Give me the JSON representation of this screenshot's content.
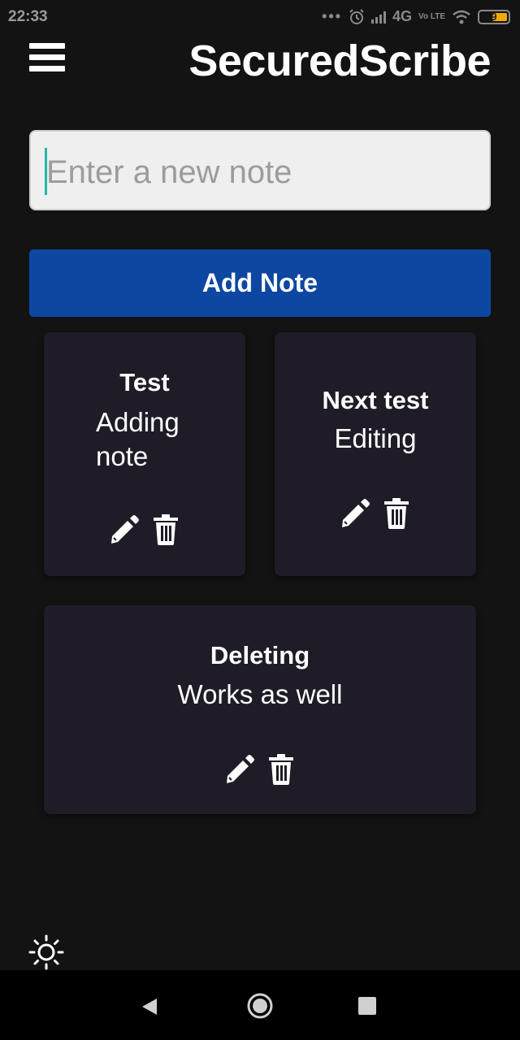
{
  "status_bar": {
    "time": "22:33",
    "network": "4G",
    "volte": "Vo LTE",
    "battery": "9",
    "battery_color": "#f2a900"
  },
  "header": {
    "menu_icon": "hamburger-menu-icon",
    "title": "SecuredScribe"
  },
  "new_note": {
    "placeholder": "Enter a new note",
    "value": ""
  },
  "add_button": {
    "label": "Add Note",
    "color": "#0d47a1"
  },
  "notes": [
    {
      "title": "Test",
      "body_line1": "Adding",
      "body_line2": "note"
    },
    {
      "title": "Next test",
      "body_line1": "Editing"
    },
    {
      "title": "Deleting",
      "body_line1": "Works as well"
    }
  ],
  "footer": {
    "theme_icon": "sun-icon"
  },
  "colors": {
    "background": "#131313",
    "card": "#1f1c27",
    "input_caret": "#1fb8a6"
  }
}
